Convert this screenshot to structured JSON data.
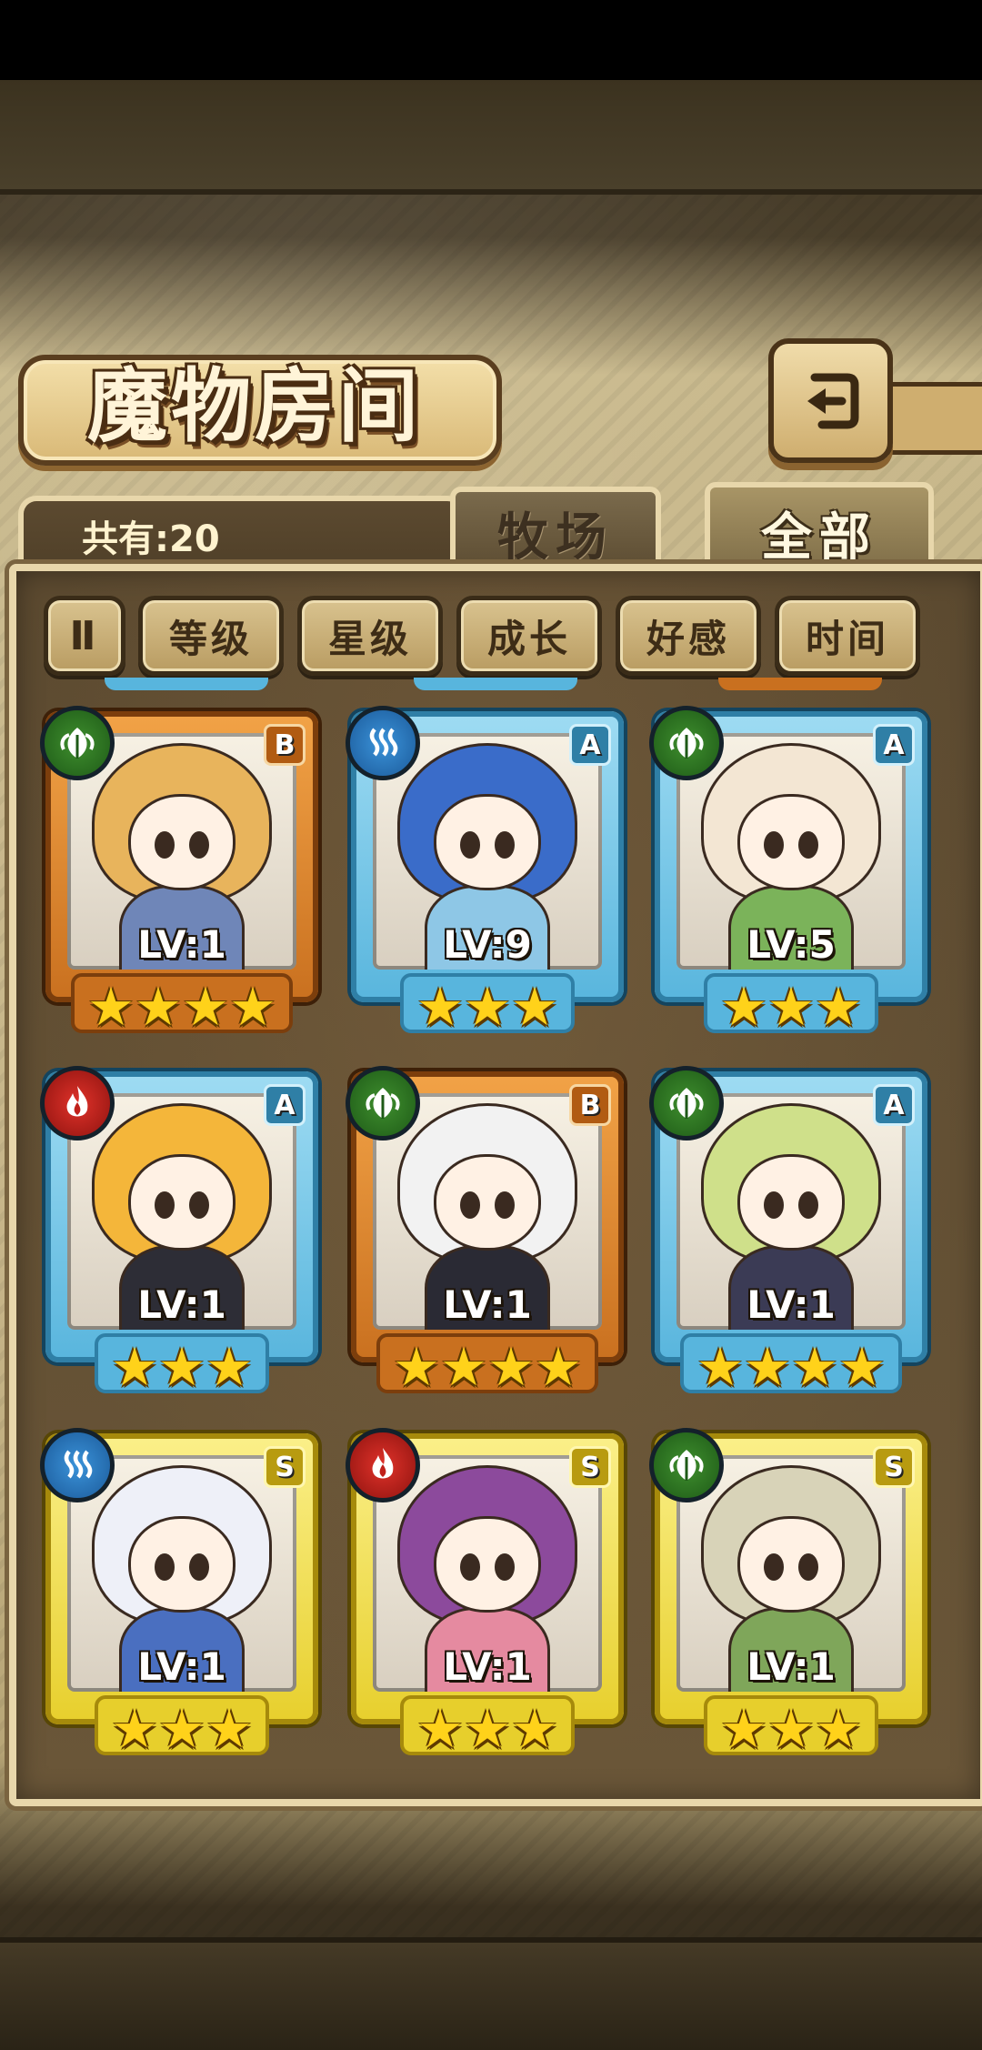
{
  "screen": {
    "title": "魔物房间",
    "count_label": "共有:20",
    "tabs": [
      {
        "label": "牧场",
        "active": false
      },
      {
        "label": "全部",
        "active": true
      }
    ],
    "sort_toggle_icon": "sort-order-icon",
    "sort_toggle_glyph": "Ⅱ",
    "sort_buttons": [
      "等级",
      "星级",
      "成长",
      "好感",
      "时间"
    ],
    "back_icon": "return-arrow-icon"
  },
  "monsters": [
    {
      "rank": "B",
      "element": "leaf",
      "level": "LV:1",
      "stars": 4,
      "hair": "#e8b45c",
      "outfit": "#6f86b8"
    },
    {
      "rank": "A",
      "element": "water",
      "level": "LV:9",
      "stars": 3,
      "hair": "#3a6cc9",
      "outfit": "#8ec7e6"
    },
    {
      "rank": "A",
      "element": "leaf",
      "level": "LV:5",
      "stars": 3,
      "hair": "#f3e6d3",
      "outfit": "#7bb35a"
    },
    {
      "rank": "A",
      "element": "fire",
      "level": "LV:1",
      "stars": 3,
      "hair": "#f4b63a",
      "outfit": "#2d2d36"
    },
    {
      "rank": "B",
      "element": "leaf",
      "level": "LV:1",
      "stars": 4,
      "hair": "#f2f2f2",
      "outfit": "#2a2a34"
    },
    {
      "rank": "A",
      "element": "leaf",
      "level": "LV:1",
      "stars": 4,
      "hair": "#cfe08a",
      "outfit": "#3b3b55"
    },
    {
      "rank": "S",
      "element": "water",
      "level": "LV:1",
      "stars": 3,
      "hair": "#eef0f8",
      "outfit": "#4a6fc0"
    },
    {
      "rank": "S",
      "element": "fire",
      "level": "LV:1",
      "stars": 3,
      "hair": "#8c4a9c",
      "outfit": "#e58aa0"
    },
    {
      "rank": "S",
      "element": "leaf",
      "level": "LV:1",
      "stars": 3,
      "hair": "#d8d3b8",
      "outfit": "#7fa65a"
    }
  ]
}
